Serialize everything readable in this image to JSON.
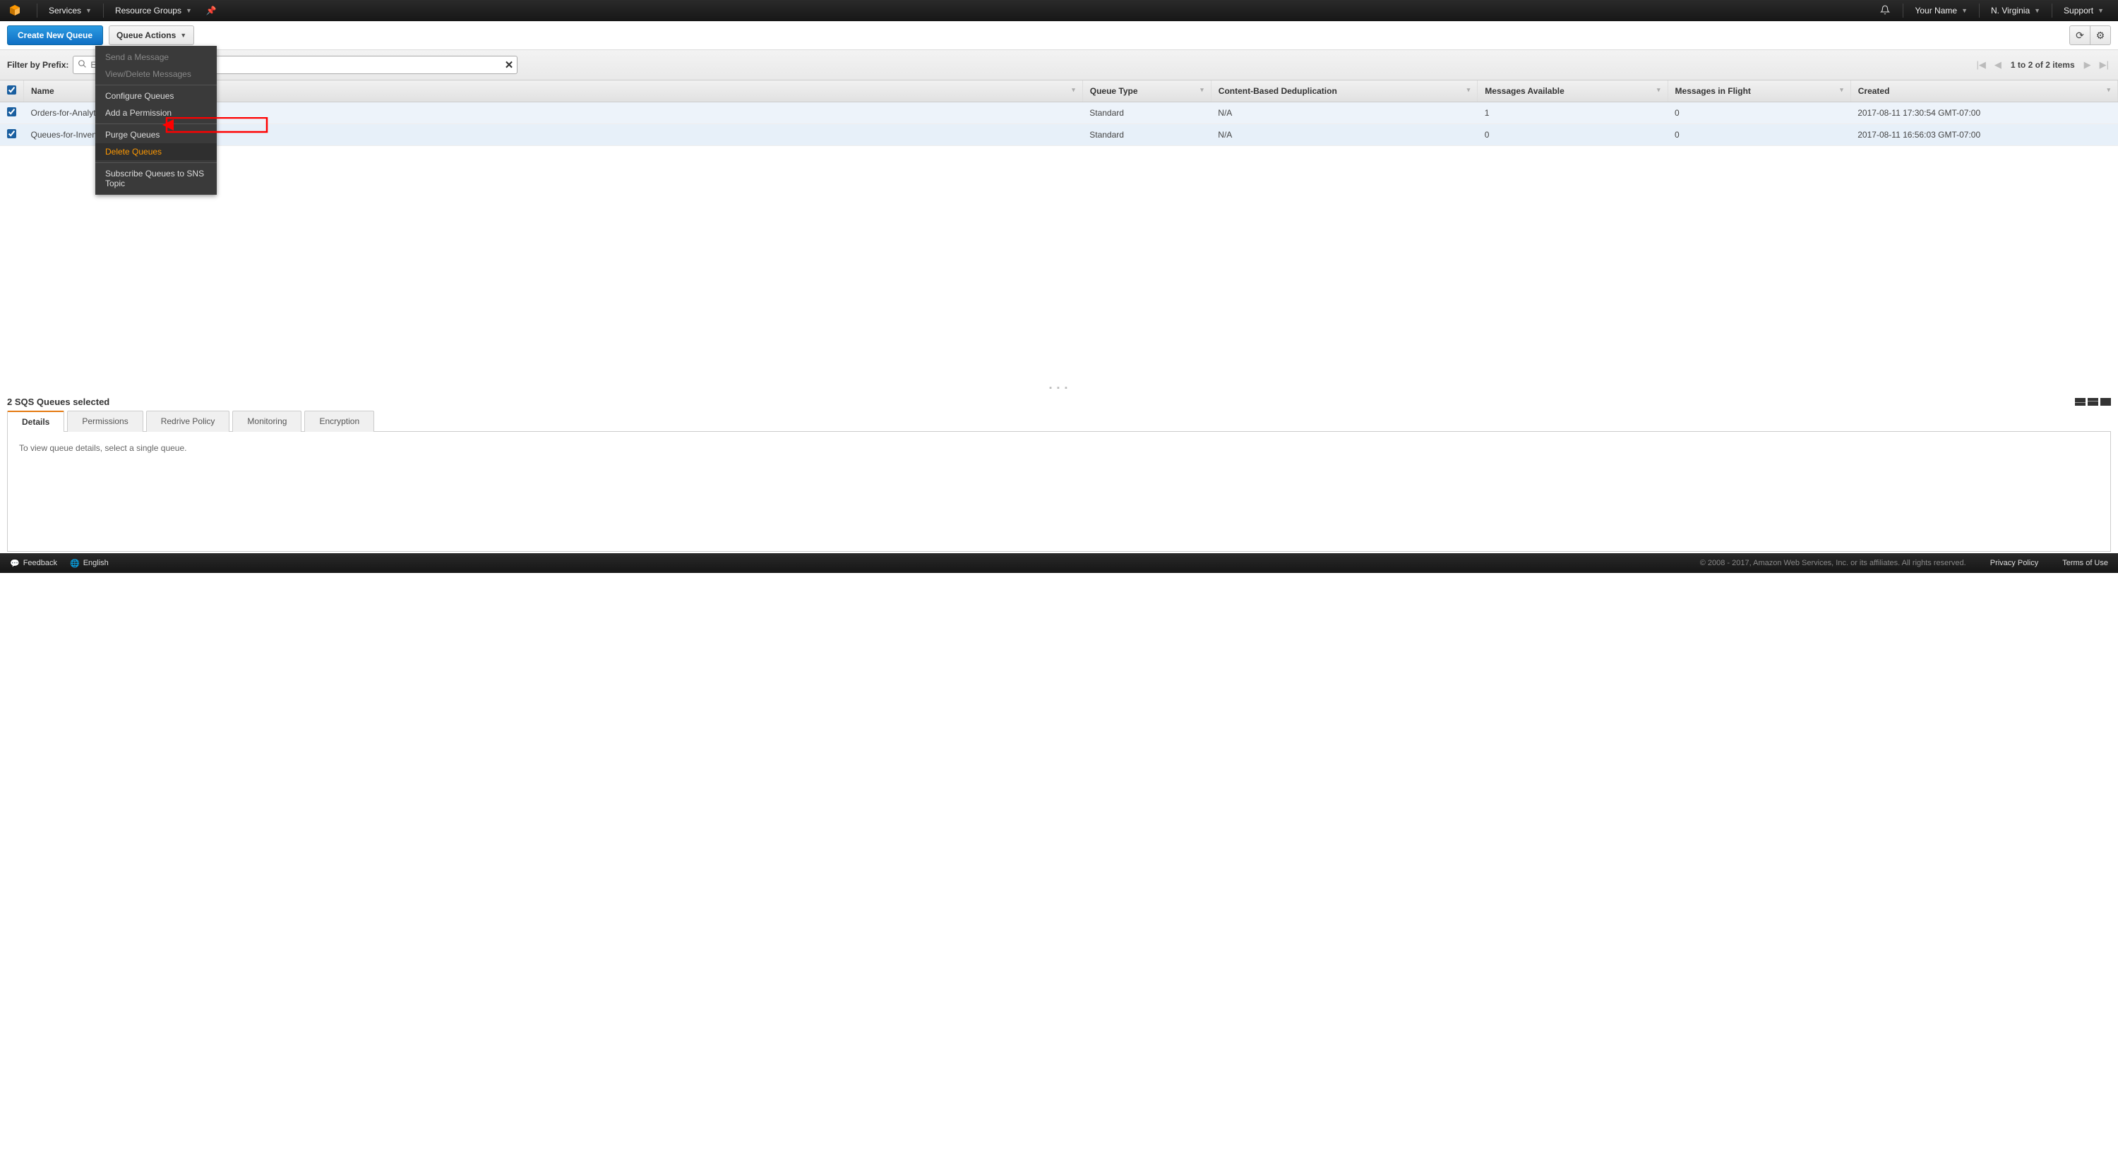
{
  "topnav": {
    "services": "Services",
    "resource_groups": "Resource Groups",
    "user": "Your Name",
    "region": "N. Virginia",
    "support": "Support"
  },
  "toolbar": {
    "create": "Create New Queue",
    "actions": "Queue Actions"
  },
  "filter": {
    "label": "Filter by Prefix:",
    "placeholder": "Ente",
    "pager_status": "1 to 2 of 2 items"
  },
  "columns": {
    "name": "Name",
    "type": "Queue Type",
    "dedup": "Content-Based Deduplication",
    "avail": "Messages Available",
    "flight": "Messages in Flight",
    "created": "Created"
  },
  "rows": [
    {
      "name": "Orders-for-Analytic",
      "type": "Standard",
      "dedup": "N/A",
      "avail": "1",
      "flight": "0",
      "created": "2017-08-11 17:30:54 GMT-07:00"
    },
    {
      "name": "Queues-for-Invento",
      "type": "Standard",
      "dedup": "N/A",
      "avail": "0",
      "flight": "0",
      "created": "2017-08-11 16:56:03 GMT-07:00"
    }
  ],
  "menu": {
    "send": "Send a Message",
    "view": "View/Delete Messages",
    "configure": "Configure Queues",
    "addperm": "Add a Permission",
    "purge": "Purge Queues",
    "delete": "Delete Queues",
    "subscribe": "Subscribe Queues to SNS Topic"
  },
  "panel": {
    "title": "2 SQS Queues selected",
    "tabs": {
      "details": "Details",
      "permissions": "Permissions",
      "redrive": "Redrive Policy",
      "monitoring": "Monitoring",
      "encryption": "Encryption"
    },
    "body": "To view queue details, select a single queue."
  },
  "footer": {
    "feedback": "Feedback",
    "language": "English",
    "copyright": "© 2008 - 2017, Amazon Web Services, Inc. or its affiliates. All rights reserved.",
    "privacy": "Privacy Policy",
    "terms": "Terms of Use"
  }
}
